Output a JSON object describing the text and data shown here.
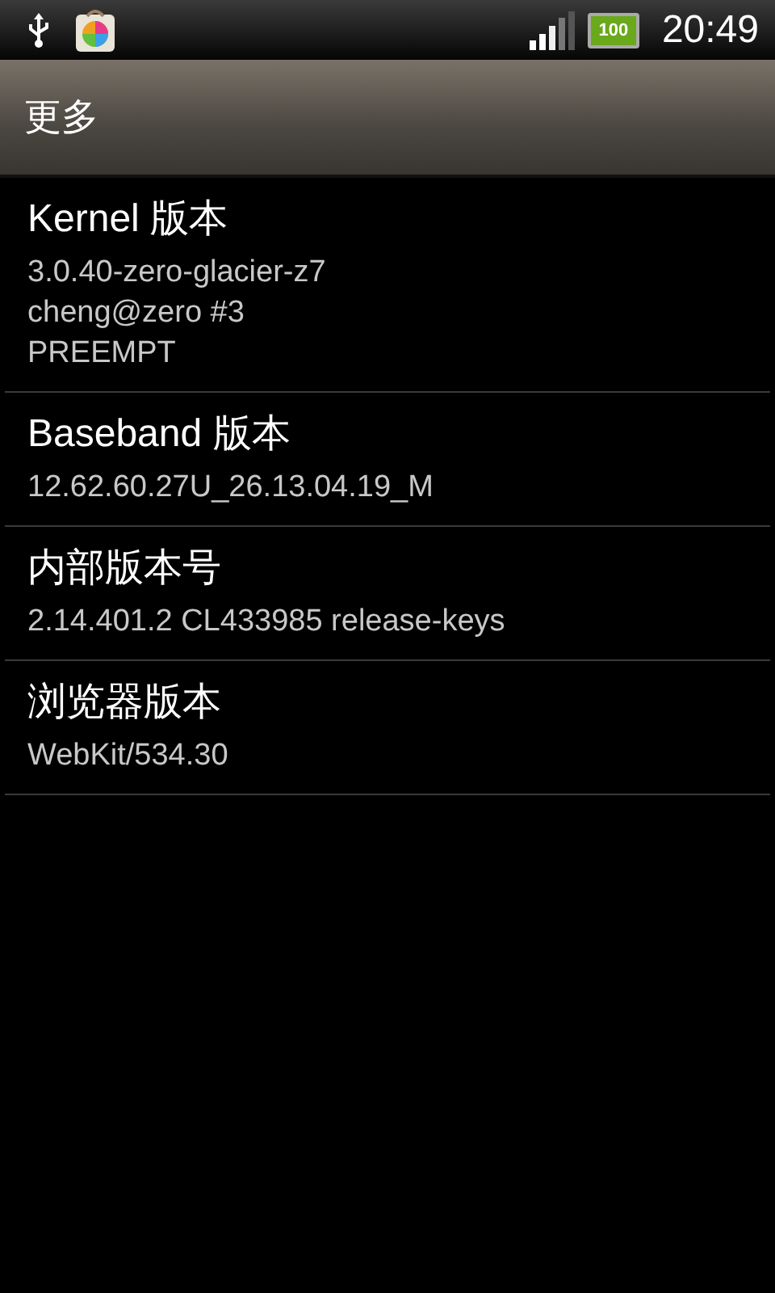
{
  "status_bar": {
    "battery_text": "100",
    "time": "20:49"
  },
  "header": {
    "title": "更多"
  },
  "items": [
    {
      "title": "Kernel 版本",
      "value": "3.0.40-zero-glacier-z7\ncheng@zero #3\nPREEMPT"
    },
    {
      "title": "Baseband 版本",
      "value": "12.62.60.27U_26.13.04.19_M"
    },
    {
      "title": "内部版本号",
      "value": "2.14.401.2 CL433985 release-keys"
    },
    {
      "title": "浏览器版本",
      "value": "WebKit/534.30"
    }
  ]
}
